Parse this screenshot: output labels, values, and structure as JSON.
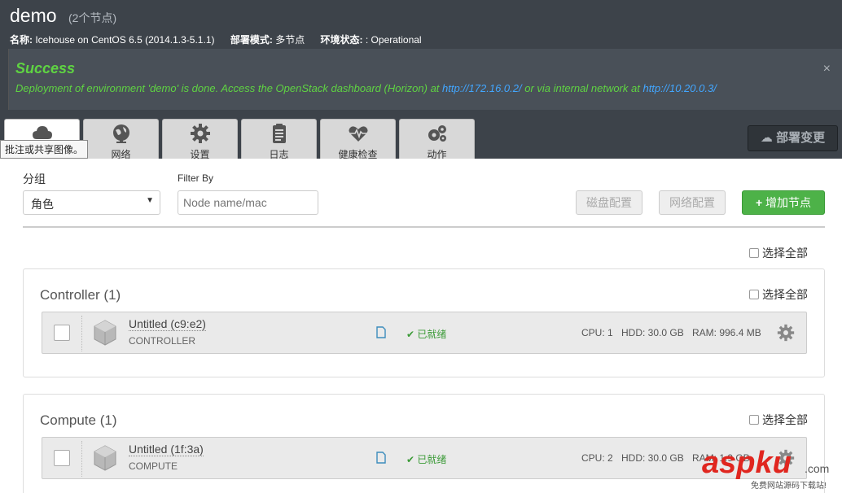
{
  "header": {
    "title": "demo",
    "count": "(2个节点)",
    "name_label": "名称:",
    "name_value": "Icehouse on CentOS 6.5 (2014.1.3-5.1.1)",
    "mode_label": "部署模式:",
    "mode_value": "多节点",
    "status_label": "环境状态:",
    "status_value": ": Operational"
  },
  "alert": {
    "title": "Success",
    "text_a": "Deployment of environment 'demo' is done. Access the OpenStack dashboard (Horizon) at ",
    "link1": "http://172.16.0.2/",
    "text_b": " or via internal network at ",
    "link2": "http://10.20.0.3/",
    "close": "×"
  },
  "tabs": [
    {
      "label": "",
      "icon": "cloud-icon"
    },
    {
      "label": "网络",
      "icon": "globe-icon"
    },
    {
      "label": "设置",
      "icon": "gear-icon"
    },
    {
      "label": "日志",
      "icon": "clipboard-icon"
    },
    {
      "label": "健康检查",
      "icon": "heartbeat-icon"
    },
    {
      "label": "动作",
      "icon": "cogs-icon"
    }
  ],
  "tooltip": "批注或共享图像。",
  "deploy_button": "部署变更",
  "toolbar": {
    "group_label": "分组",
    "group_value": "角色",
    "filter_label": "Filter By",
    "filter_placeholder": "Node name/mac",
    "disk_button": "磁盘配置",
    "network_button": "网络配置",
    "add_node_button": "增加节点",
    "select_all": "选择全部"
  },
  "groups": [
    {
      "title": "Controller (1)",
      "select_all": "选择全部",
      "node": {
        "name": "Untitled (c9:e2)",
        "role": "CONTROLLER",
        "status": "已就绪",
        "cpu": "CPU: 1",
        "hdd": "HDD: 30.0 GB",
        "ram": "RAM: 996.4 MB"
      }
    },
    {
      "title": "Compute (1)",
      "select_all": "选择全部",
      "node": {
        "name": "Untitled (1f:3a)",
        "role": "COMPUTE",
        "status": "已就绪",
        "cpu": "CPU: 2",
        "hdd": "HDD: 30.0 GB",
        "ram": "RAM: 1.9 GB"
      }
    }
  ],
  "watermark": {
    "brand": "aspku",
    "suffix": ".com",
    "sub": "免费网站源码下载站!"
  }
}
